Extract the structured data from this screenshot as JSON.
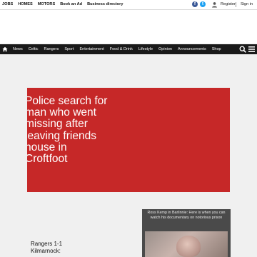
{
  "top_links": [
    "JOBS",
    "HOMES",
    "MOTORS",
    "Book an Ad",
    "Business directory"
  ],
  "account": {
    "register": "Register",
    "signin": "Sign in"
  },
  "nav": [
    "News",
    "Celtic",
    "Rangers",
    "Sport",
    "Entertainment",
    "Food & Drink",
    "Lifestyle",
    "Opinion",
    "Announcements",
    "Shop"
  ],
  "hero": {
    "title": "Police search for man who went missing after leaving friends house in Croftfoot"
  },
  "story": {
    "text": "Rangers 1-1 Kilmarnock:"
  },
  "card": {
    "title": "Ross Kemp in Barlinnie: Here is when you can watch his documentary on notorious prison"
  },
  "colors": {
    "hero_bg": "#c62828",
    "nav_bg": "#1a1a1a"
  }
}
